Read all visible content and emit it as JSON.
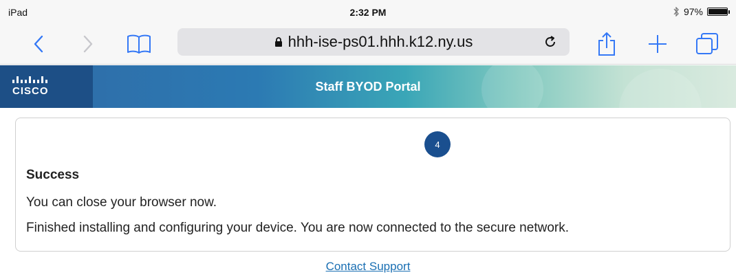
{
  "status_bar": {
    "device": "iPad",
    "time": "2:32 PM",
    "battery_percent": "97%",
    "battery_level": 0.97,
    "bluetooth_icon": "bluetooth-icon"
  },
  "browser": {
    "url": "hhh-ise-ps01.hhh.k12.ny.us",
    "icons": [
      "back-icon",
      "forward-icon",
      "bookmarks-icon",
      "lock-icon",
      "reload-icon",
      "share-icon",
      "new-tab-icon",
      "tabs-icon"
    ]
  },
  "portal": {
    "brand": "CISCO",
    "title": "Staff BYOD Portal",
    "step_number": "4",
    "success_title": "Success",
    "message_1": "You can close your browser now.",
    "message_2": "Finished installing and configuring your device. You are now connected to the secure network.",
    "contact_link": "Contact Support"
  },
  "colors": {
    "header_dark": "#1d4f86",
    "step_badge": "#1a4f8f",
    "link": "#1a6fb3",
    "ios_blue": "#3478f6"
  }
}
